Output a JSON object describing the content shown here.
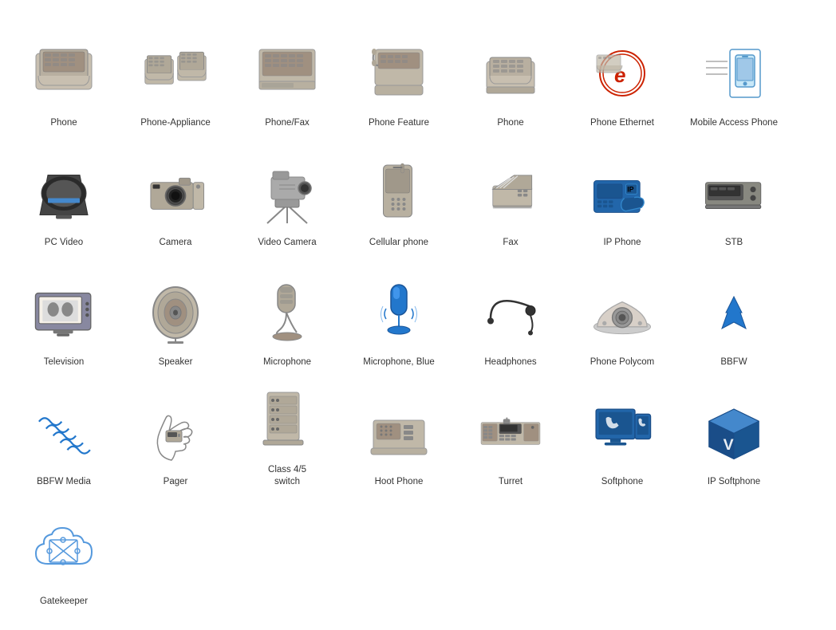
{
  "items": [
    {
      "id": "phone",
      "label": "Phone",
      "row": 1
    },
    {
      "id": "phone-appliance",
      "label": "Phone-Appliance",
      "row": 1
    },
    {
      "id": "phone-fax",
      "label": "Phone/Fax",
      "row": 1
    },
    {
      "id": "phone-feature",
      "label": "Phone Feature",
      "row": 1
    },
    {
      "id": "phone2",
      "label": "Phone",
      "row": 1
    },
    {
      "id": "phone-ethernet",
      "label": "Phone Ethernet",
      "row": 1
    },
    {
      "id": "mobile-access-phone",
      "label": "Mobile Access Phone",
      "row": 1
    },
    {
      "id": "pc-video",
      "label": "PC Video",
      "row": 2
    },
    {
      "id": "camera",
      "label": "Camera",
      "row": 2
    },
    {
      "id": "video-camera",
      "label": "Video Camera",
      "row": 2
    },
    {
      "id": "cellular-phone",
      "label": "Cellular phone",
      "row": 2
    },
    {
      "id": "fax",
      "label": "Fax",
      "row": 2
    },
    {
      "id": "ip-phone",
      "label": "IP Phone",
      "row": 2
    },
    {
      "id": "stb",
      "label": "STB",
      "row": 2
    },
    {
      "id": "television",
      "label": "Television",
      "row": 3
    },
    {
      "id": "speaker",
      "label": "Speaker",
      "row": 3
    },
    {
      "id": "microphone",
      "label": "Microphone",
      "row": 3
    },
    {
      "id": "microphone-blue",
      "label": "Microphone, Blue",
      "row": 3
    },
    {
      "id": "headphones",
      "label": "Headphones",
      "row": 3
    },
    {
      "id": "phone-polycom",
      "label": "Phone Polycom",
      "row": 3
    },
    {
      "id": "bbfw",
      "label": "BBFW",
      "row": 3
    },
    {
      "id": "bbfw-media",
      "label": "BBFW Media",
      "row": 3
    },
    {
      "id": "pager",
      "label": "Pager",
      "row": 4
    },
    {
      "id": "class-switch",
      "label": "Class 4/5\nswitch",
      "row": 4
    },
    {
      "id": "hoot-phone",
      "label": "Hoot Phone",
      "row": 4
    },
    {
      "id": "turret",
      "label": "Turret",
      "row": 4
    },
    {
      "id": "softphone",
      "label": "Softphone",
      "row": 4
    },
    {
      "id": "ip-softphone",
      "label": "IP Softphone",
      "row": 4
    },
    {
      "id": "gatekeeper",
      "label": "Gatekeeper",
      "row": 4
    }
  ]
}
